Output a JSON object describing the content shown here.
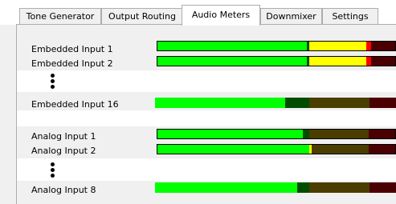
{
  "tabs": [
    {
      "label": "Tone Generator",
      "active": false
    },
    {
      "label": "Output Routing",
      "active": false
    },
    {
      "label": "Audio Meters",
      "active": true
    },
    {
      "label": "Downmixer",
      "active": false
    },
    {
      "label": "Settings",
      "active": false
    }
  ],
  "meters": {
    "embedded": [
      {
        "label": "Embedded Input 1",
        "green": 0.63,
        "yellow": 0.24,
        "red": 0.02
      },
      {
        "label": "Embedded Input 2",
        "green": 0.63,
        "yellow": 0.24,
        "red": 0.02
      },
      {
        "label": "Embedded Input 16",
        "green": 0.54,
        "yellow": 0.0,
        "red": 0.0
      }
    ],
    "analog": [
      {
        "label": "Analog Input 1",
        "green": 0.61,
        "yellow": 0.0,
        "red": 0.0
      },
      {
        "label": "Analog Input 2",
        "green": 0.64,
        "yellow": 0.01,
        "red": 0.0
      },
      {
        "label": "Analog Input 8",
        "green": 0.59,
        "yellow": 0.0,
        "red": 0.0
      }
    ]
  },
  "colors": {
    "green": "#00ff00",
    "dark_green": "#004d00",
    "yellow": "#ffff00",
    "dark_yellow": "#4a3d00",
    "red": "#ff0000",
    "dark_red": "#4a0000"
  }
}
